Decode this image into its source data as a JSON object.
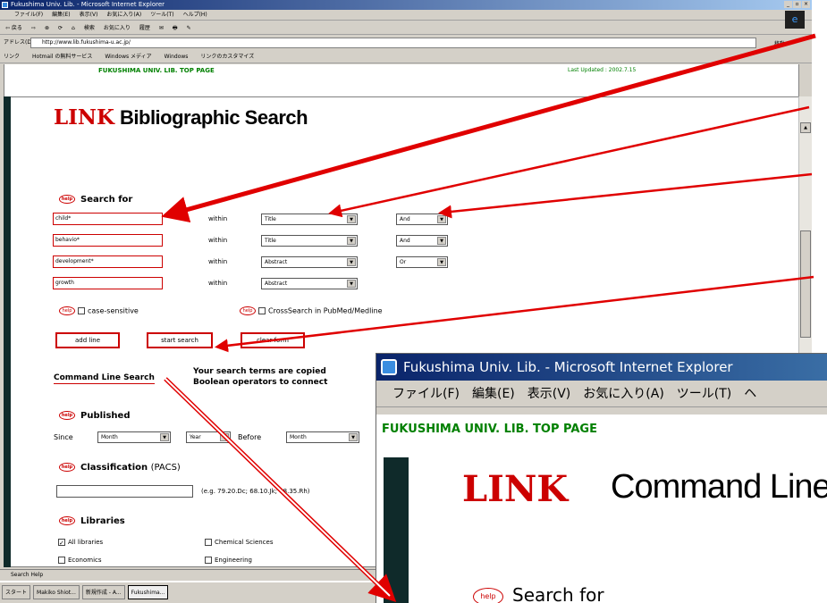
{
  "main_window": {
    "title": "Fukushima Univ. Lib. - Microsoft Internet Explorer",
    "menu": [
      "ファイル(F)",
      "編集(E)",
      "表示(V)",
      "お気に入り(A)",
      "ツール(T)",
      "ヘルプ(H)"
    ],
    "toolbar": [
      "⇦ 戻る",
      "⇨",
      "⊗",
      "⟳",
      "⌂",
      "検索",
      "お気に入り",
      "履歴",
      "✉",
      "🖶",
      "✎"
    ],
    "address_label": "アドレス(D)",
    "address_value": "http://www.lib.fukushima-u.ac.jp/",
    "go_label": "移動",
    "links_label": "リンク",
    "links": [
      "Hotmail の無料サービス",
      "Windows メディア",
      "Windows",
      "リンクのカスタマイズ"
    ],
    "status_text": "Search Help",
    "taskbar": [
      "スタート",
      "Makiko Shiot...",
      "新規作成 - A...",
      "Fukushima..."
    ]
  },
  "page": {
    "top_link": "FUKUSHIMA UNIV. LIB. TOP PAGE",
    "last_updated": "Last Updated : 2002.7.15",
    "title_link": "LINK",
    "title_rest": "Bibliographic Search",
    "help_label": "help",
    "search_for_label": "Search for",
    "within_label": "within",
    "rows": [
      {
        "term": "child*",
        "field": "Title",
        "op": "And"
      },
      {
        "term": "behavio*",
        "field": "Title",
        "op": "And"
      },
      {
        "term": "development*",
        "field": "Abstract",
        "op": "Or"
      },
      {
        "term": "growth",
        "field": "Abstract",
        "op": ""
      }
    ],
    "case_sensitive_label": "case-sensitive",
    "crosssearch_label": "CrossSearch in PubMed/Medline",
    "buttons": {
      "add_line": "add line",
      "start_search": "start search",
      "clear_form": "clear form"
    },
    "command_line_search": "Command Line Search",
    "command_desc_line1": "Your search terms are copied",
    "command_desc_line2": "Boolean operators to connect",
    "published_label": "Published",
    "since_label": "Since",
    "before_label": "Before",
    "month_label": "Month",
    "year_label": "Year",
    "classification_label": "Classification",
    "classification_suffix": "(PACS)",
    "classification_example": "(e.g. 79.20.Dc; 68.10.Jk; 68.35.Rh)",
    "libraries_label": "Libraries",
    "libraries": [
      "All libraries",
      "Chemical Sciences",
      "Economics",
      "Engineering"
    ]
  },
  "zoom_window": {
    "title": "Fukushima Univ. Lib. - Microsoft Internet Explorer",
    "menu": [
      "ファイル(F)",
      "編集(E)",
      "表示(V)",
      "お気に入り(A)",
      "ツール(T)",
      "ヘ"
    ],
    "top_link": "FUKUSHIMA UNIV. LIB. TOP PAGE",
    "title_link": "LINK",
    "title_rest": "Command Line",
    "help_label": "help",
    "search_for_label": "Search for"
  },
  "colors": {
    "accent_red": "#cc0000",
    "link_green": "#008000",
    "sidebar_dark": "#0f2a2a",
    "title_blue": "#0a246a"
  }
}
